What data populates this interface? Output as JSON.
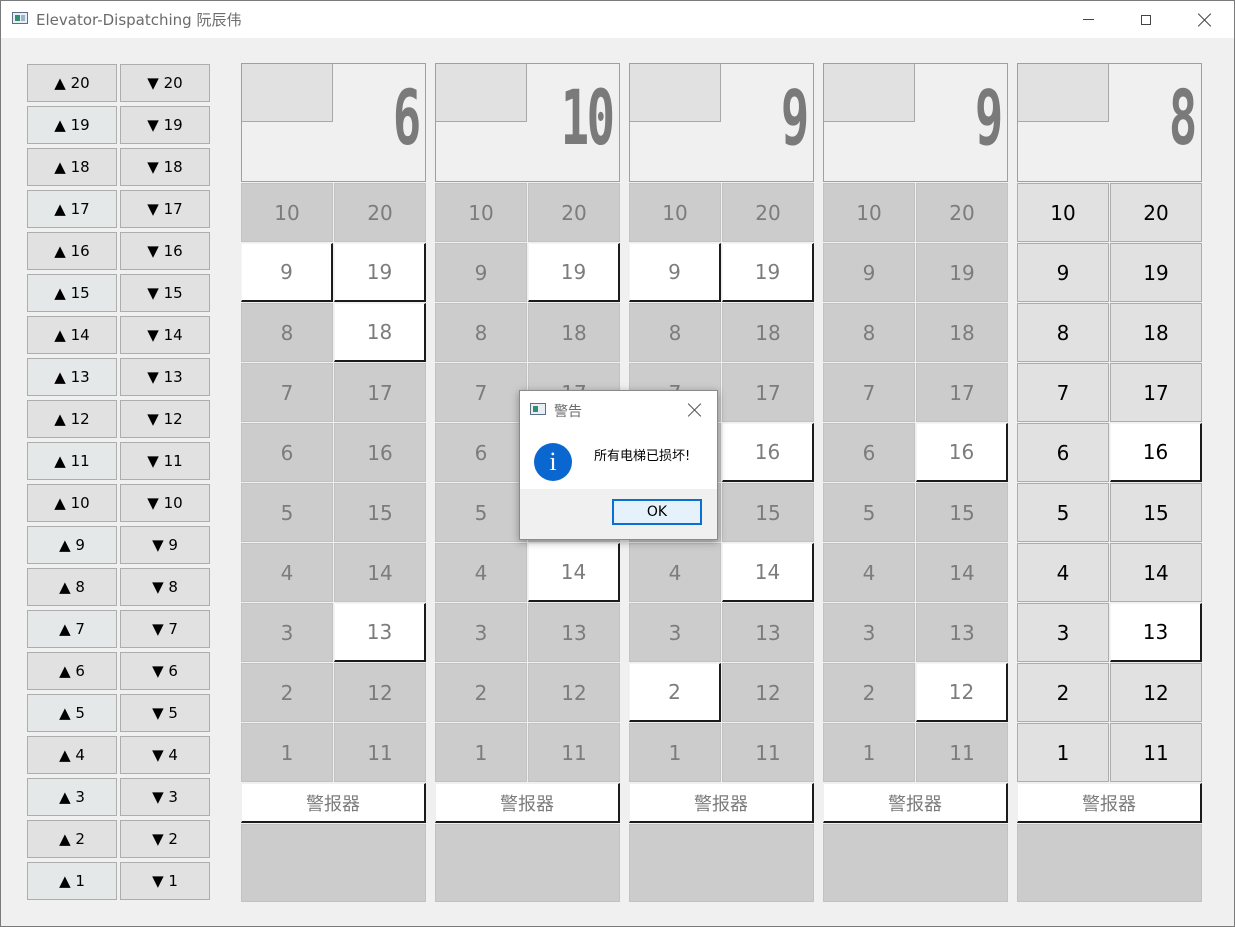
{
  "window": {
    "title": "Elevator-Dispatching 阮辰伟"
  },
  "floor_calls": [
    {
      "floor": 20,
      "up": "▲ 20",
      "down": "▼ 20"
    },
    {
      "floor": 19,
      "up": "▲ 19",
      "down": "▼ 19"
    },
    {
      "floor": 18,
      "up": "▲ 18",
      "down": "▼ 18"
    },
    {
      "floor": 17,
      "up": "▲ 17",
      "down": "▼ 17"
    },
    {
      "floor": 16,
      "up": "▲ 16",
      "down": "▼ 16"
    },
    {
      "floor": 15,
      "up": "▲ 15",
      "down": "▼ 15"
    },
    {
      "floor": 14,
      "up": "▲ 14",
      "down": "▼ 14"
    },
    {
      "floor": 13,
      "up": "▲ 13",
      "down": "▼ 13"
    },
    {
      "floor": 12,
      "up": "▲ 12",
      "down": "▼ 12"
    },
    {
      "floor": 11,
      "up": "▲ 11",
      "down": "▼ 11"
    },
    {
      "floor": 10,
      "up": "▲ 10",
      "down": "▼ 10"
    },
    {
      "floor": 9,
      "up": "▲ 9",
      "down": "▼ 9"
    },
    {
      "floor": 8,
      "up": "▲ 8",
      "down": "▼ 8"
    },
    {
      "floor": 7,
      "up": "▲ 7",
      "down": "▼ 7"
    },
    {
      "floor": 6,
      "up": "▲ 6",
      "down": "▼ 6"
    },
    {
      "floor": 5,
      "up": "▲ 5",
      "down": "▼ 5"
    },
    {
      "floor": 4,
      "up": "▲ 4",
      "down": "▼ 4"
    },
    {
      "floor": 3,
      "up": "▲ 3",
      "down": "▼ 3"
    },
    {
      "floor": 2,
      "up": "▲ 2",
      "down": "▼ 2"
    },
    {
      "floor": 1,
      "up": "▲ 1",
      "down": "▼ 1"
    }
  ],
  "elevators": [
    {
      "display": "6",
      "disabled": true,
      "lit_floors": [
        9,
        19,
        18,
        13
      ],
      "alarm_label": "警报器"
    },
    {
      "display": "10",
      "disabled": true,
      "lit_floors": [
        19,
        14
      ],
      "alarm_label": "警报器"
    },
    {
      "display": "9",
      "disabled": true,
      "lit_floors": [
        9,
        19,
        16,
        14,
        2
      ],
      "alarm_label": "警报器"
    },
    {
      "display": "9",
      "disabled": true,
      "lit_floors": [
        16,
        12
      ],
      "alarm_label": "警报器"
    },
    {
      "display": "8",
      "disabled": false,
      "lit_floors": [
        16,
        13
      ],
      "alarm_label": "警报器"
    }
  ],
  "floor_rows": [
    [
      10,
      20
    ],
    [
      9,
      19
    ],
    [
      8,
      18
    ],
    [
      7,
      17
    ],
    [
      6,
      16
    ],
    [
      5,
      15
    ],
    [
      4,
      14
    ],
    [
      3,
      13
    ],
    [
      2,
      12
    ],
    [
      1,
      11
    ]
  ],
  "dialog": {
    "title": "警告",
    "message": "所有电梯已损坏!",
    "ok_label": "OK",
    "icon": "i"
  },
  "icons": {
    "app": "app-window-icon",
    "info": "info-icon"
  }
}
